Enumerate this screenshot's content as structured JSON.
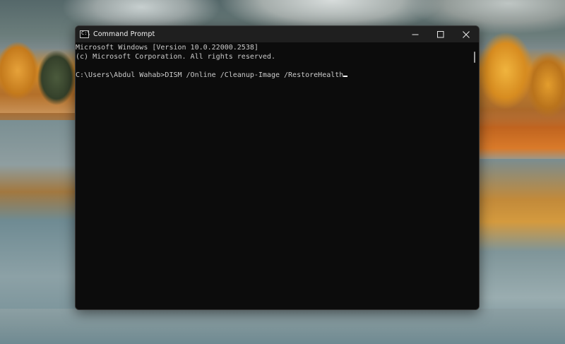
{
  "window": {
    "title": "Command Prompt",
    "app_icon": "cmd-icon",
    "app_icon_glyph": "C:\\",
    "controls": {
      "minimize_icon": "minimize-icon",
      "maximize_icon": "maximize-icon",
      "close_icon": "close-icon"
    }
  },
  "console": {
    "lines": [
      "Microsoft Windows [Version 10.0.22000.2538]",
      "(c) Microsoft Corporation. All rights reserved.",
      "",
      "C:\\Users\\Abdul Wahab>DISM /Online /Cleanup-Image /RestoreHealth"
    ],
    "text_color": "#cccccc",
    "background_color": "#0c0c0c"
  },
  "colors": {
    "titlebar": "#1f1f1f",
    "title_text": "#f2f2f2"
  }
}
